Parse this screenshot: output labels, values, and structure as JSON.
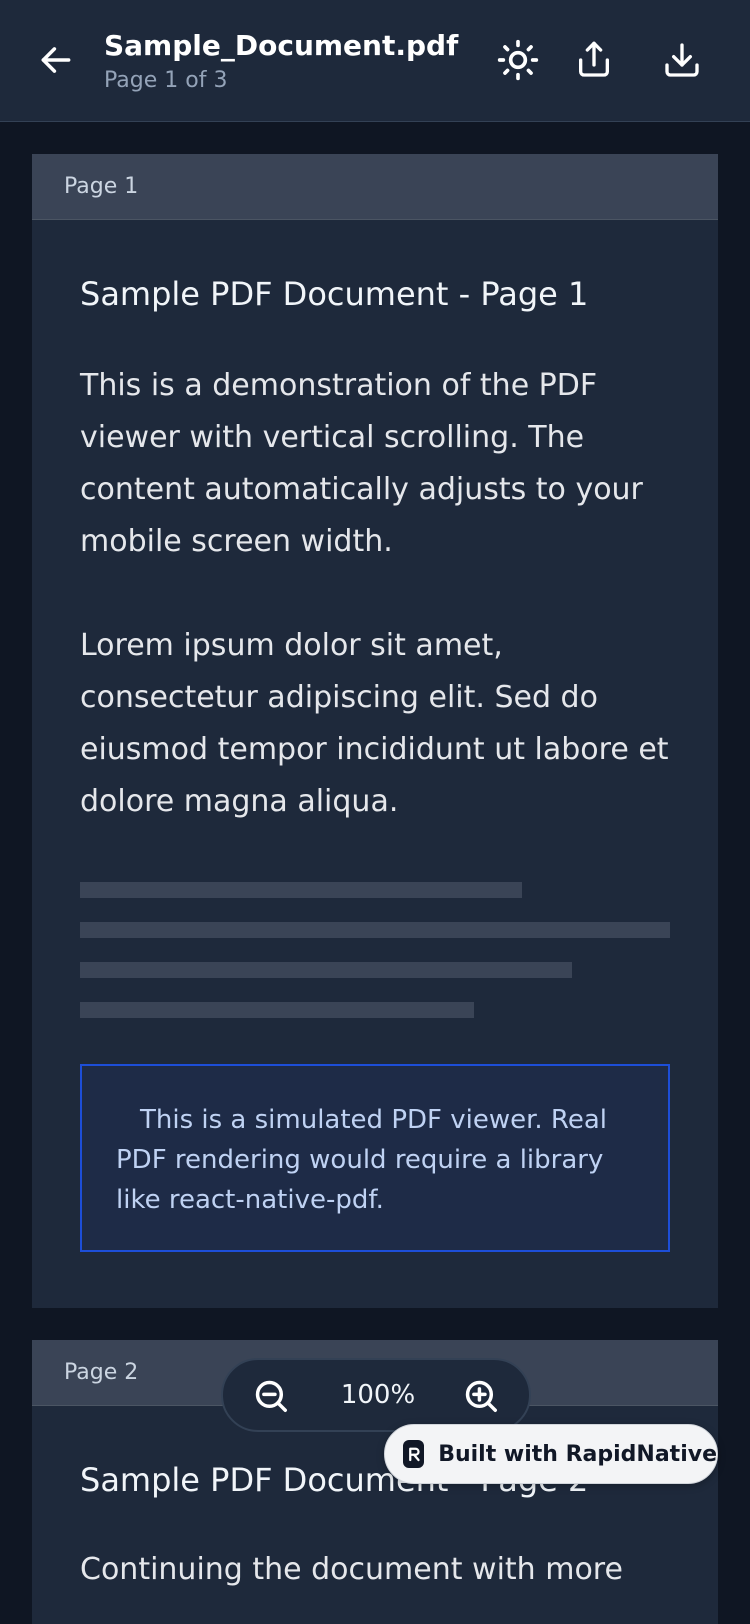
{
  "header": {
    "title": "Sample_Document.pdf",
    "subtitle": "Page 1 of 3",
    "icons": [
      "arrow-left-icon",
      "sun-icon",
      "share-icon",
      "download-icon"
    ]
  },
  "pages": [
    {
      "label": "Page 1",
      "heading": "Sample PDF Document - Page 1",
      "paragraphs": [
        "This is a demonstration of the PDF viewer with vertical scrolling. The content automatically adjusts to your mobile screen width.",
        "Lorem ipsum dolor sit amet, consectetur adipiscing elit. Sed do eiusmod tempor incididunt ut labore et dolore magna aliqua."
      ],
      "notice": "This is a simulated PDF viewer. Real PDF rendering would require a library like react-native-pdf."
    },
    {
      "label": "Page 2",
      "heading": "Sample PDF Document - Page 2",
      "paragraphs": [
        "Continuing the document with more"
      ]
    }
  ],
  "zoom": {
    "level": "100%"
  },
  "badge": {
    "text": "Built with RapidNative"
  },
  "colors": {
    "background": "#0f1623",
    "surface": "#1e293b",
    "accent": "#1d4ed8"
  }
}
